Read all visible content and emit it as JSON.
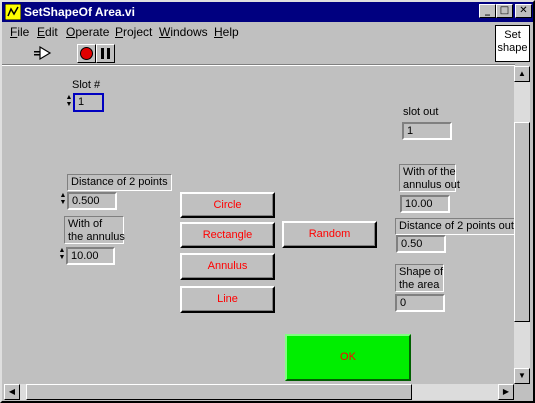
{
  "window": {
    "title": "SetShapeOf Area.vi"
  },
  "menu": [
    {
      "label": "File",
      "accel": "F",
      "rest": "ile"
    },
    {
      "label": "Edit",
      "accel": "E",
      "rest": "dit"
    },
    {
      "label": "Operate",
      "accel": "O",
      "rest": "perate"
    },
    {
      "label": "Project",
      "accel": "P",
      "rest": "roject"
    },
    {
      "label": "Windows",
      "accel": "W",
      "rest": "indows"
    },
    {
      "label": "Help",
      "accel": "H",
      "rest": "elp"
    }
  ],
  "icon_pane": {
    "line1": "Set",
    "line2": "shape"
  },
  "controls": {
    "slot_num": {
      "label": "Slot #",
      "value": "1"
    },
    "distance": {
      "label": "Distance of 2 points",
      "value": "0.500"
    },
    "annulus_width": {
      "label1": "With of",
      "label2": "the annulus",
      "value": "10.00"
    }
  },
  "buttons": {
    "circle": "Circle",
    "rectangle": "Rectangle",
    "annulus": "Annulus",
    "line": "Line",
    "random": "Random",
    "ok": "OK"
  },
  "indicators": {
    "slot_out": {
      "label": "slot out",
      "value": "1"
    },
    "annulus_out": {
      "label1": "With of the",
      "label2": "annulus out",
      "value": "10.00"
    },
    "distance_out": {
      "label": "Distance of 2 points out",
      "value": "0.50"
    },
    "shape": {
      "label1": "Shape of",
      "label2": "the area",
      "value": "0"
    }
  },
  "colors": {
    "titlebar": "#000080",
    "ok_button": "#00ee00",
    "button_text": "#ff0000"
  }
}
